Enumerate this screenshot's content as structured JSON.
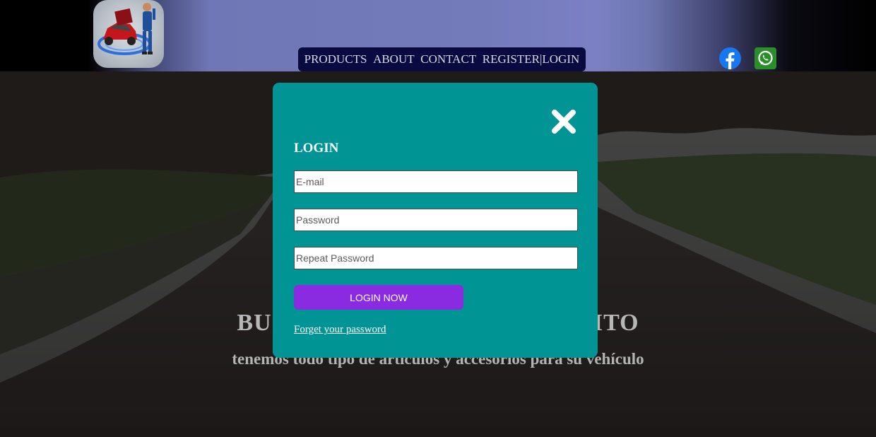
{
  "colors": {
    "nav_bg": "#080a40",
    "modal_bg": "#009494",
    "login_button": "#8a2be2",
    "facebook": "#1877f2",
    "whatsapp": "#25d366"
  },
  "header": {
    "logo": "mechanic-car-logo",
    "nav": [
      {
        "label": "PRODUCTS"
      },
      {
        "label": "ABOUT"
      },
      {
        "label": "CONTACT"
      },
      {
        "label": "REGISTER|LOGIN"
      }
    ],
    "social": [
      {
        "icon": "facebook-icon"
      },
      {
        "icon": "whatsapp-icon"
      }
    ]
  },
  "hero": {
    "title": "BUSCA TU REPUESTO FAVORITO",
    "subtitle": "tenemos todo tipo de artículos y accesorios para su vehículo"
  },
  "modal": {
    "close_icon": "close-icon",
    "title": "LOGIN",
    "email_placeholder": "E-mail",
    "password_placeholder": "Password",
    "repeat_password_placeholder": "Repeat Password",
    "submit_label": "LOGIN NOW",
    "forgot_link": "Forget your password"
  }
}
